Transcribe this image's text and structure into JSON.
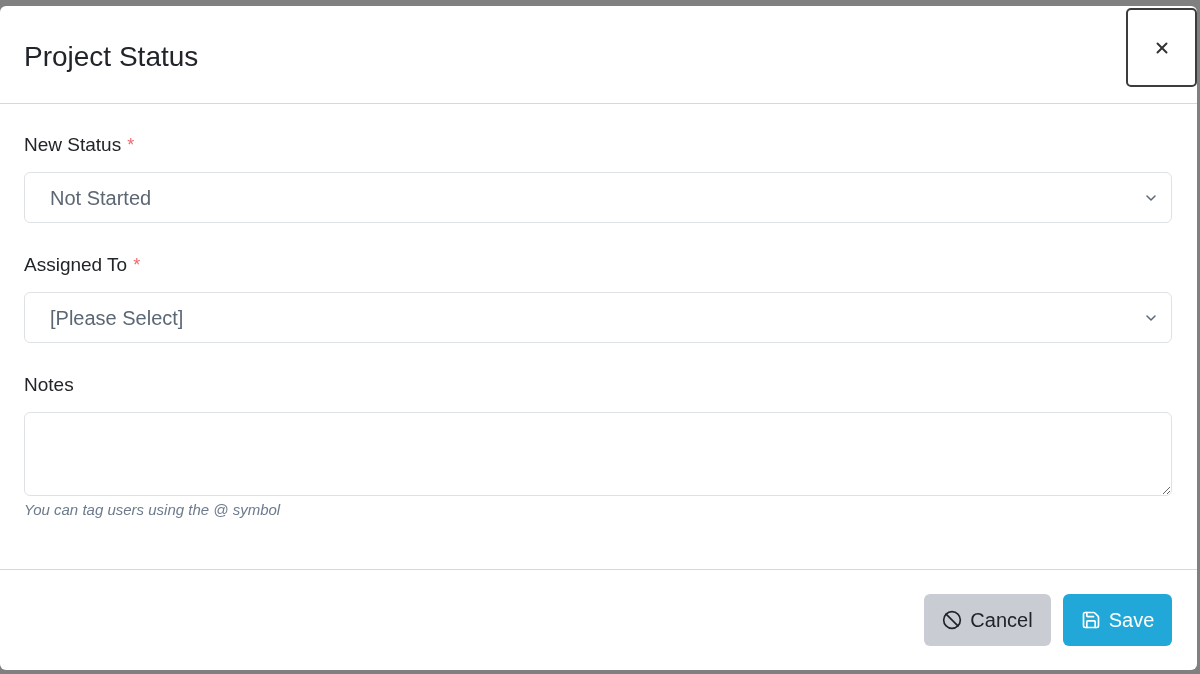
{
  "dialog": {
    "title": "Project Status"
  },
  "fields": [
    {
      "kind": "select",
      "label": "New Status",
      "required_marker": "*",
      "value": "Not Started"
    },
    {
      "kind": "select",
      "label": "Assigned To",
      "required_marker": "*",
      "value": "[Please Select]"
    },
    {
      "kind": "textarea",
      "label": "Notes",
      "help": "You can tag users using the @ symbol"
    }
  ],
  "buttons": [
    {
      "kind": "cancel",
      "label": "Cancel"
    },
    {
      "kind": "save",
      "label": "Save"
    }
  ]
}
